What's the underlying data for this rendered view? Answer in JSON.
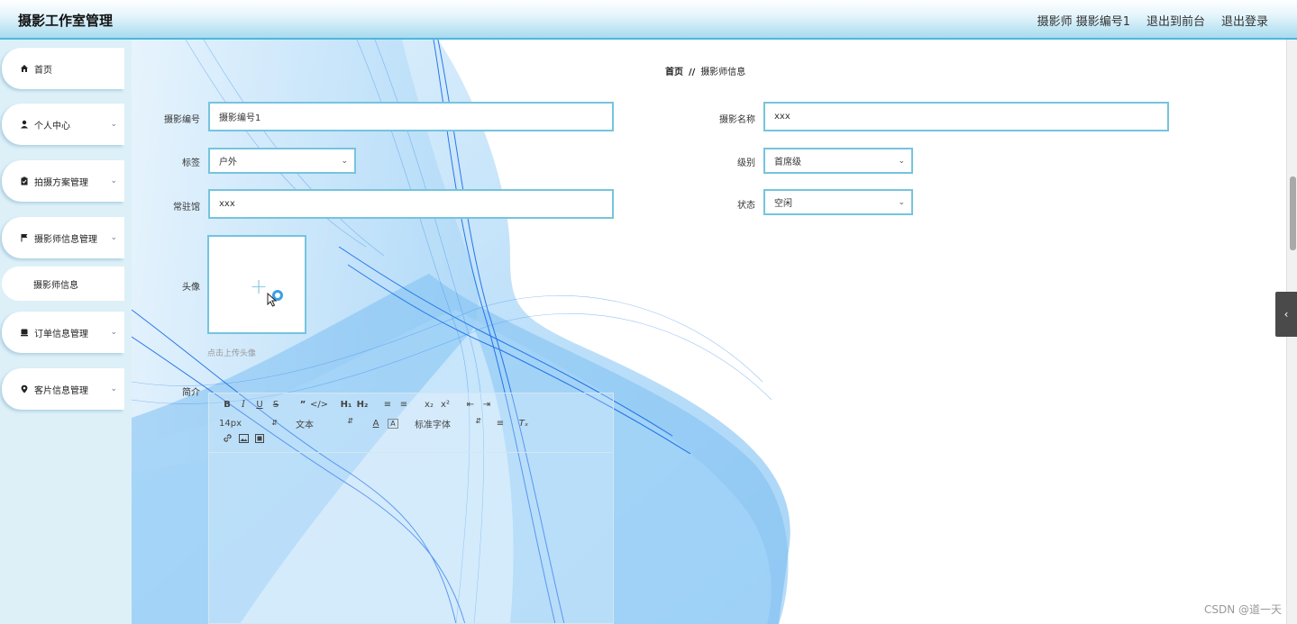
{
  "header": {
    "app_title": "摄影工作室管理",
    "user_label": "摄影师 摄影编号1",
    "front_link": "退出到前台",
    "logout_link": "退出登录"
  },
  "sidebar": {
    "items": [
      {
        "label": "首页",
        "icon": "home-icon"
      },
      {
        "label": "个人中心",
        "icon": "user-icon"
      },
      {
        "label": "拍摄方案管理",
        "icon": "clipboard-icon"
      },
      {
        "label": "摄影师信息管理",
        "icon": "flag-icon"
      },
      {
        "label": "订单信息管理",
        "icon": "order-icon"
      },
      {
        "label": "客片信息管理",
        "icon": "pin-icon"
      }
    ],
    "sub_item": "摄影师信息"
  },
  "breadcrumb": {
    "home": "首页",
    "separator": "//",
    "current": "摄影师信息"
  },
  "form": {
    "photographer_no_label": "摄影编号",
    "photographer_no_value": "摄影编号1",
    "photographer_name_label": "摄影名称",
    "photographer_name_value": "xxx",
    "tag_label": "标签",
    "tag_value": "户外",
    "level_label": "级别",
    "level_value": "首席级",
    "studio_label": "常驻馆",
    "studio_value": "xxx",
    "status_label": "状态",
    "status_value": "空闲",
    "avatar_label": "头像",
    "avatar_hint": "点击上传头像",
    "intro_label": "简介"
  },
  "editor": {
    "font_size": "14px",
    "text_type": "文本",
    "font_family": "标准字体"
  },
  "watermark": "CSDN @道一天",
  "colors": {
    "accent": "#4fb6dc",
    "input_border": "#75c4de",
    "sidebar_bg": "#ddf0f8"
  }
}
